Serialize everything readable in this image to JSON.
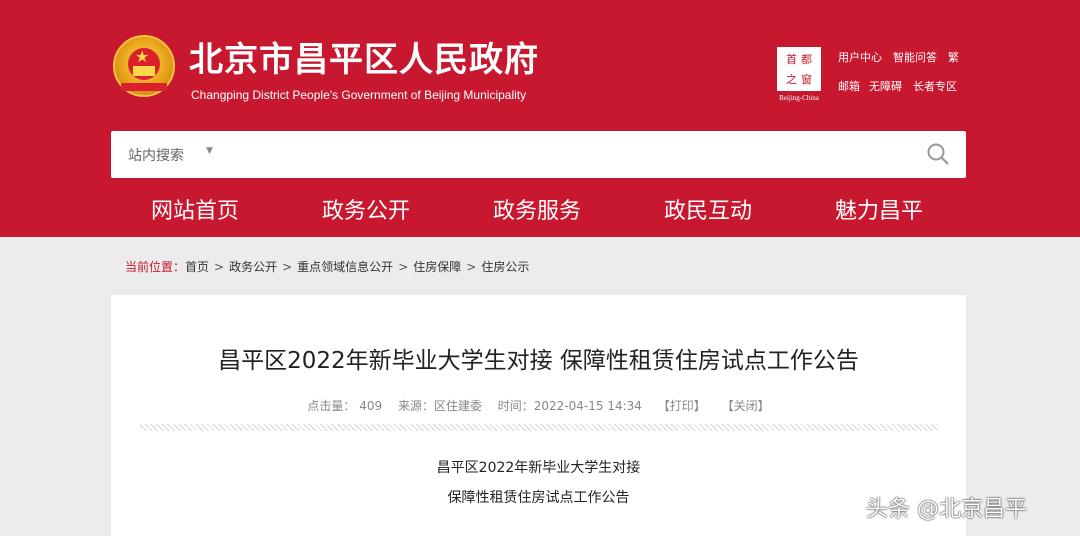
{
  "header": {
    "title": "北京市昌平区人民政府",
    "subtitle": "Changping District People's Government of Beijing Municipality",
    "seal_text": "首都之窗",
    "seal_caption": "Beijing-China",
    "utility_links": [
      "用户中心",
      "智能问答",
      "繁",
      "邮箱",
      "无障碍",
      "长者专区"
    ],
    "brand_color": "#c8182f"
  },
  "search": {
    "label": "站内搜索",
    "placeholder": ""
  },
  "nav": [
    "网站首页",
    "政务公开",
    "政务服务",
    "政民互动",
    "魅力昌平"
  ],
  "breadcrumb": {
    "label": "当前位置：",
    "items": [
      "首页",
      "政务公开",
      "重点领域信息公开",
      "住房保障",
      "住房公示"
    ]
  },
  "article": {
    "title": "昌平区2022年新毕业大学生对接 保障性租赁住房试点工作公告",
    "meta": {
      "clicks": "点击量： 409",
      "source": "来源：区住建委",
      "time": "时间：2022-04-15 14:34",
      "print": "【打印】",
      "close": "【关闭】"
    },
    "body_lines": [
      "昌平区2022年新毕业大学生对接",
      "保障性租赁住房试点工作公告"
    ]
  },
  "watermark": "头条 @北京昌平"
}
